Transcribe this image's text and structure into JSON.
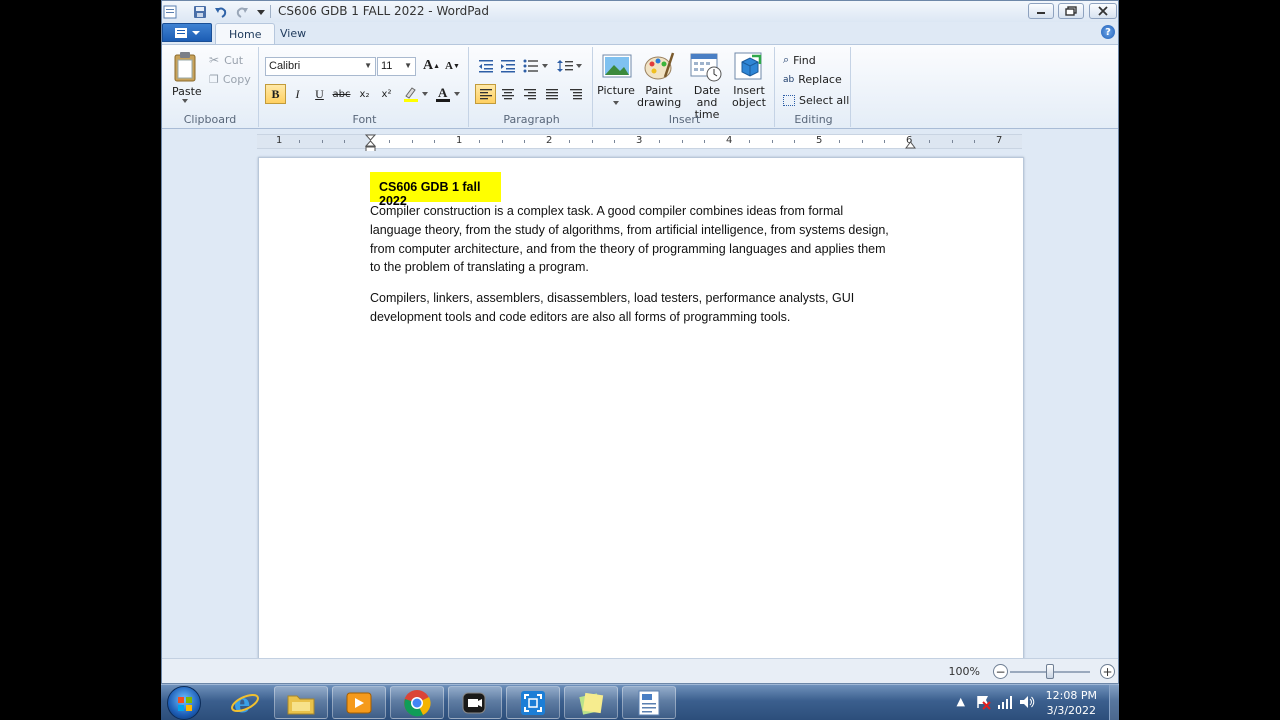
{
  "window": {
    "title": "CS606 GDB 1 FALL 2022 - WordPad"
  },
  "tabs": [
    {
      "label": "Home",
      "active": true
    },
    {
      "label": "View",
      "active": false
    }
  ],
  "ribbon": {
    "clipboard": {
      "group_label": "Clipboard",
      "paste": "Paste",
      "cut": "Cut",
      "copy": "Copy"
    },
    "font": {
      "group_label": "Font",
      "font_family": "Calibri",
      "font_size": "11",
      "bold": "B",
      "italic": "I",
      "underline": "U",
      "strikethrough": "abc",
      "subscript": "x₂",
      "superscript": "x²"
    },
    "paragraph": {
      "group_label": "Paragraph"
    },
    "insert": {
      "group_label": "Insert",
      "picture": "Picture",
      "paint_line1": "Paint",
      "paint_line2": "drawing",
      "datetime_line1": "Date and",
      "datetime_line2": "time",
      "object_line1": "Insert",
      "object_line2": "object"
    },
    "editing": {
      "group_label": "Editing",
      "find": "Find",
      "replace": "Replace",
      "select_all": "Select all"
    }
  },
  "ruler": {
    "numbers": [
      "1",
      "1",
      "2",
      "3",
      "4",
      "5",
      "6",
      "7"
    ]
  },
  "document": {
    "title": "CS606 GDB 1 fall 2022",
    "paragraph1": "Compiler construction is a complex task. A good compiler combines ideas from formal language theory, from the study of algorithms, from artificial intelligence, from systems design, from computer architecture, and from the theory of programming languages and applies them to the problem of translating a program.",
    "paragraph2": "Compilers, linkers, assemblers, disassemblers, load testers, performance analysts, GUI development tools and code editors are also all forms of programming tools.",
    "highlight_color": "#ffff00"
  },
  "status": {
    "zoom": "100%",
    "zoom_out": "−",
    "zoom_in": "+"
  },
  "taskbar": {
    "time": "12:08 PM",
    "date": "3/3/2022"
  },
  "colors": {
    "accent": "#1c5db4",
    "ribbon_bg": "#e4edf7",
    "highlight": "#ffff00"
  }
}
